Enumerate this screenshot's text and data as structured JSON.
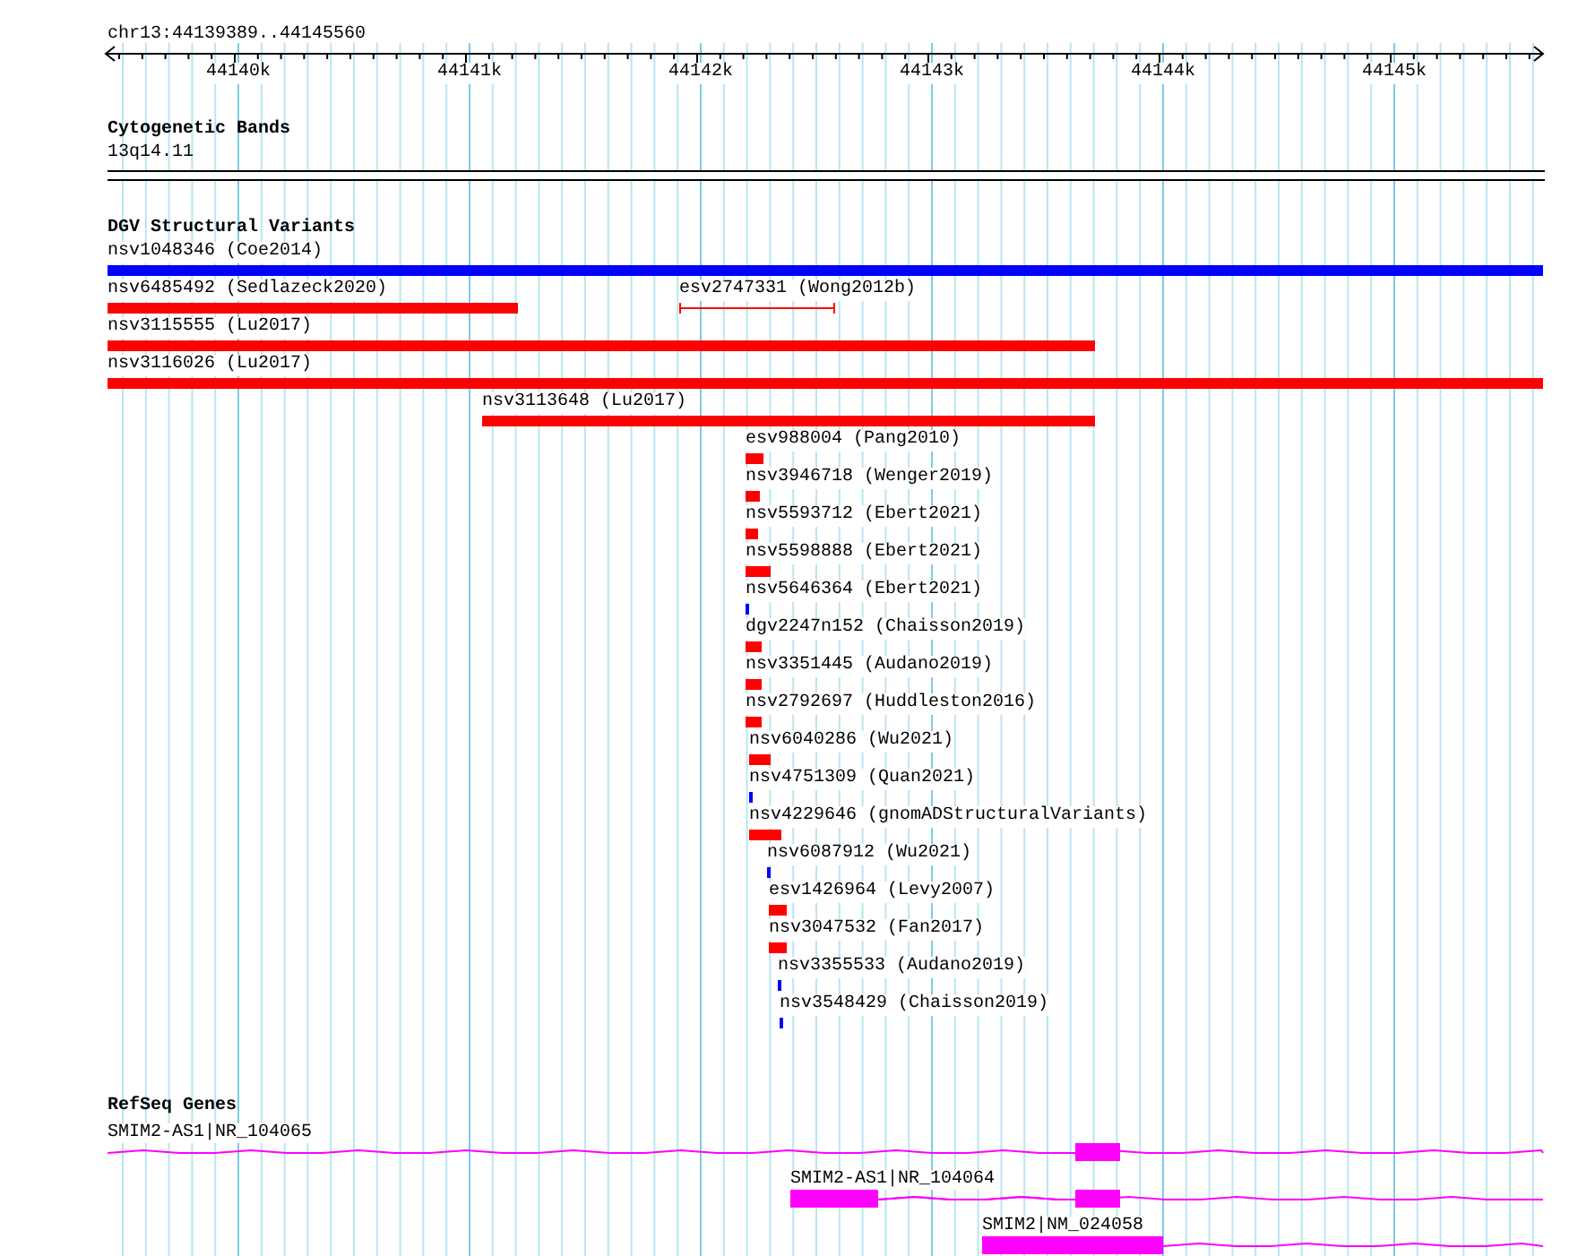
{
  "ruler": {
    "location": "chr13:44139389..44145560",
    "ticks": [
      "44140k",
      "44141k",
      "44142k",
      "44143k",
      "44144k",
      "44145k"
    ]
  },
  "cytogenetic_bands": {
    "title": "Cytogenetic Bands",
    "bands": [
      {
        "label": "13q14.11"
      }
    ]
  },
  "dgv": {
    "title": "DGV Structural Variants",
    "rows": [
      {
        "features": [
          {
            "label": "nsv1048346 (Coe2014)",
            "kind": "bar",
            "color": "#0000ff"
          }
        ]
      },
      {
        "features": [
          {
            "label": "nsv6485492 (Sedlazeck2020)",
            "kind": "bar",
            "color": "#ff0000"
          },
          {
            "label": "esv2747331 (Wong2012b)",
            "kind": "span",
            "color": "#ff0000"
          }
        ]
      },
      {
        "features": [
          {
            "label": "nsv3115555 (Lu2017)",
            "kind": "bar",
            "color": "#ff0000"
          }
        ]
      },
      {
        "features": [
          {
            "label": "nsv3116026 (Lu2017)",
            "kind": "bar",
            "color": "#ff0000"
          }
        ]
      },
      {
        "features": [
          {
            "label": "nsv3113648 (Lu2017)",
            "kind": "bar",
            "color": "#ff0000"
          }
        ]
      },
      {
        "features": [
          {
            "label": "esv988004 (Pang2010)",
            "kind": "bar",
            "color": "#ff0000"
          }
        ]
      },
      {
        "features": [
          {
            "label": "nsv3946718 (Wenger2019)",
            "kind": "bar",
            "color": "#ff0000"
          }
        ]
      },
      {
        "features": [
          {
            "label": "nsv5593712 (Ebert2021)",
            "kind": "bar",
            "color": "#ff0000"
          }
        ]
      },
      {
        "features": [
          {
            "label": "nsv5598888 (Ebert2021)",
            "kind": "bar",
            "color": "#ff0000"
          }
        ]
      },
      {
        "features": [
          {
            "label": "nsv5646364 (Ebert2021)",
            "kind": "bar",
            "color": "#0000ff"
          }
        ]
      },
      {
        "features": [
          {
            "label": "dgv2247n152 (Chaisson2019)",
            "kind": "bar",
            "color": "#ff0000"
          }
        ]
      },
      {
        "features": [
          {
            "label": "nsv3351445 (Audano2019)",
            "kind": "bar",
            "color": "#ff0000"
          }
        ]
      },
      {
        "features": [
          {
            "label": "nsv2792697 (Huddleston2016)",
            "kind": "bar",
            "color": "#ff0000"
          }
        ]
      },
      {
        "features": [
          {
            "label": "nsv6040286 (Wu2021)",
            "kind": "bar",
            "color": "#ff0000"
          }
        ]
      },
      {
        "features": [
          {
            "label": "nsv4751309 (Quan2021)",
            "kind": "bar",
            "color": "#0000ff"
          }
        ]
      },
      {
        "features": [
          {
            "label": "nsv4229646 (gnomADStructuralVariants)",
            "kind": "bar",
            "color": "#ff0000"
          }
        ]
      },
      {
        "features": [
          {
            "label": "nsv6087912 (Wu2021)",
            "kind": "bar",
            "color": "#0000ff"
          }
        ]
      },
      {
        "features": [
          {
            "label": "esv1426964 (Levy2007)",
            "kind": "bar",
            "color": "#ff0000"
          }
        ]
      },
      {
        "features": [
          {
            "label": "nsv3047532 (Fan2017)",
            "kind": "bar",
            "color": "#ff0000"
          }
        ]
      },
      {
        "features": [
          {
            "label": "nsv3355533 (Audano2019)",
            "kind": "bar",
            "color": "#0000ff"
          }
        ]
      },
      {
        "features": [
          {
            "label": "nsv3548429 (Chaisson2019)",
            "kind": "bar",
            "color": "#0000ff"
          }
        ]
      }
    ]
  },
  "refseq_genes": {
    "title": "RefSeq Genes",
    "transcripts": [
      {
        "label": "SMIM2-AS1|NR_104065"
      },
      {
        "label": "SMIM2-AS1|NR_104064"
      },
      {
        "label": "SMIM2|NM_024058"
      }
    ]
  }
}
